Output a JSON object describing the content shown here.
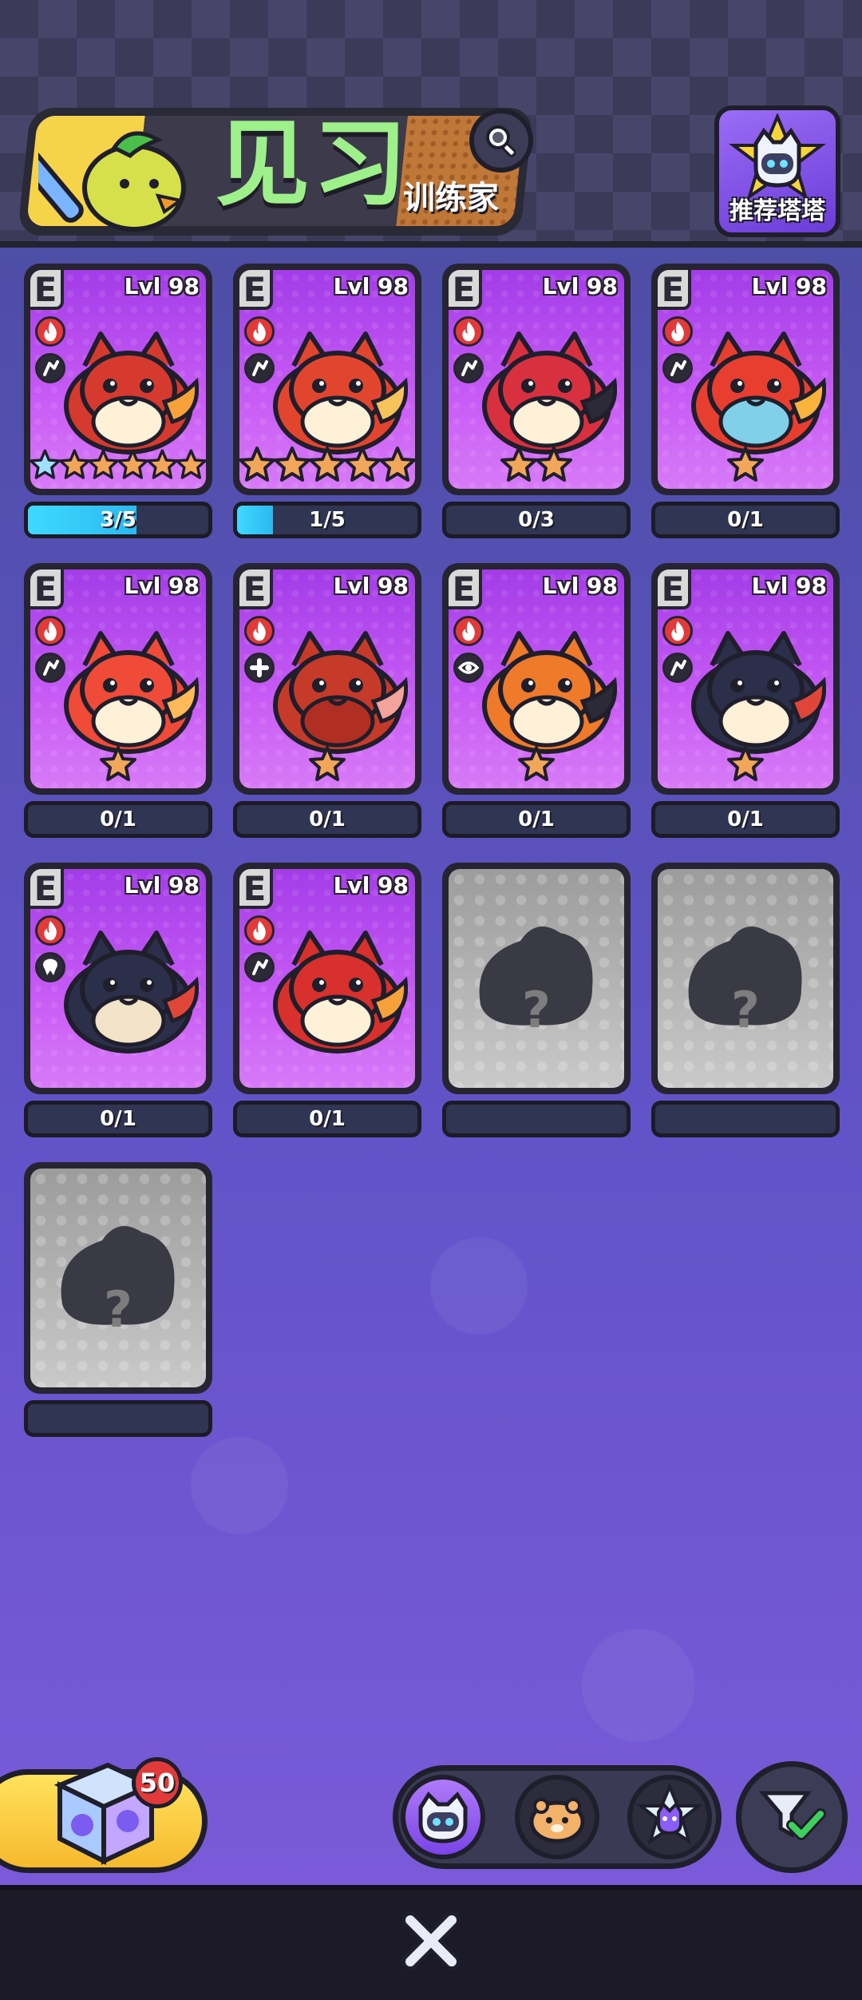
{
  "header": {
    "title": "见习",
    "subtitle": "训练家",
    "recommend_label": "推荐塔塔"
  },
  "colors": {
    "header_bg": "#3b3a58",
    "card_purple": "#c95cf5",
    "fire_type": "#e23a3a",
    "progress_fill": "#3fd9ff",
    "title_green": "#9ef08a",
    "locked_gray": "#c9c9c9"
  },
  "cards": [
    {
      "rank": "E",
      "level": "Lvl 98",
      "element_icon": "fire-icon",
      "role_icon": "claw-icon",
      "creature": "fire-bird-creature",
      "stars": 6,
      "blue_stars": 1,
      "progress": "3/5",
      "progress_fraction": 0.6
    },
    {
      "rank": "E",
      "level": "Lvl 98",
      "element_icon": "fire-icon",
      "role_icon": "claw-icon",
      "creature": "fire-hamster-creature",
      "stars": 5,
      "blue_stars": 0,
      "progress": "1/5",
      "progress_fraction": 0.2
    },
    {
      "rank": "E",
      "level": "Lvl 98",
      "element_icon": "fire-icon",
      "role_icon": "claw-icon",
      "creature": "ladybug-creature",
      "stars": 2,
      "blue_stars": 0,
      "progress": "0/3",
      "progress_fraction": 0
    },
    {
      "rank": "E",
      "level": "Lvl 98",
      "element_icon": "fire-icon",
      "role_icon": "claw-icon",
      "creature": "fire-frog-creature",
      "stars": 1,
      "blue_stars": 0,
      "progress": "0/1",
      "progress_fraction": 0
    },
    {
      "rank": "E",
      "level": "Lvl 98",
      "element_icon": "fire-icon",
      "role_icon": "claw-icon",
      "creature": "fire-fox-creature",
      "stars": 1,
      "blue_stars": 0,
      "progress": "0/1",
      "progress_fraction": 0
    },
    {
      "rank": "E",
      "level": "Lvl 98",
      "element_icon": "fire-icon",
      "role_icon": "heal-icon",
      "creature": "chili-pig-creature",
      "stars": 1,
      "blue_stars": 0,
      "progress": "0/1",
      "progress_fraction": 0
    },
    {
      "rank": "E",
      "level": "Lvl 98",
      "element_icon": "fire-icon",
      "role_icon": "eye-icon",
      "creature": "tiger-creature",
      "stars": 1,
      "blue_stars": 0,
      "progress": "0/1",
      "progress_fraction": 0
    },
    {
      "rank": "E",
      "level": "Lvl 98",
      "element_icon": "fire-icon",
      "role_icon": "claw-icon",
      "creature": "dark-cat-creature",
      "stars": 1,
      "blue_stars": 0,
      "progress": "0/1",
      "progress_fraction": 0
    },
    {
      "rank": "E",
      "level": "Lvl 98",
      "element_icon": "fire-icon",
      "role_icon": "tooth-icon",
      "creature": "dark-pup-creature",
      "stars": 0,
      "blue_stars": 0,
      "progress": "0/1",
      "progress_fraction": 0
    },
    {
      "rank": "E",
      "level": "Lvl 98",
      "element_icon": "fire-icon",
      "role_icon": "claw-icon",
      "creature": "fire-parrot-creature",
      "stars": 0,
      "blue_stars": 0,
      "progress": "0/1",
      "progress_fraction": 0
    }
  ],
  "locked_cards": [
    {
      "label": "?"
    },
    {
      "label": "?"
    },
    {
      "label": "?"
    }
  ],
  "bottom": {
    "gift_count": "50",
    "filters": [
      "robot-cat-filter-icon",
      "hamster-filter-icon",
      "crystal-cat-filter-icon"
    ]
  }
}
